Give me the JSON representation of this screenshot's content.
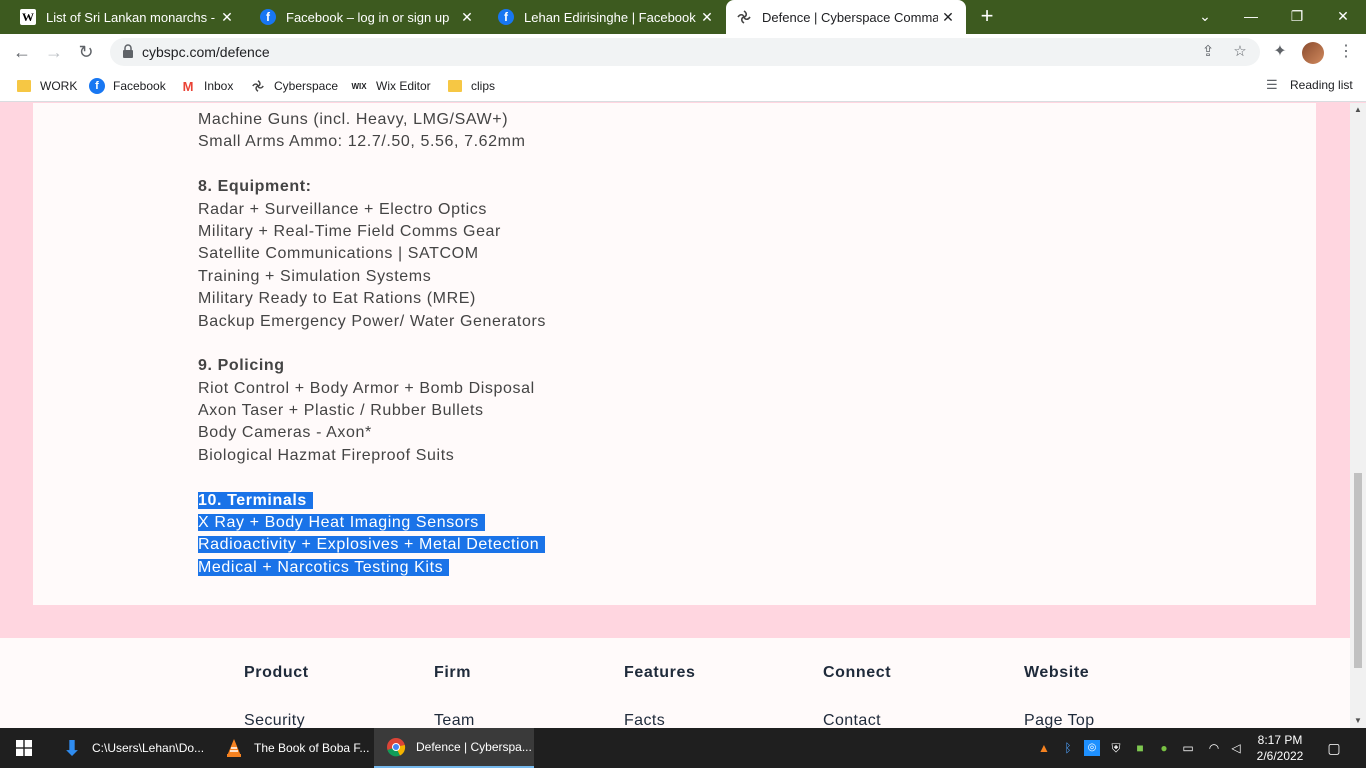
{
  "browser": {
    "tabs": [
      {
        "title": "List of Sri Lankan monarchs - Wik",
        "favicon": "wikipedia-icon",
        "active": false
      },
      {
        "title": "Facebook – log in or sign up",
        "favicon": "facebook-icon",
        "active": false
      },
      {
        "title": "Lehan Edirisinghe | Facebook",
        "favicon": "facebook-icon",
        "active": false
      },
      {
        "title": "Defence | Cyberspace Command",
        "favicon": "cyberspace-icon",
        "active": true
      }
    ],
    "url": "cybspc.com/defence",
    "bookmarks": [
      {
        "label": "WORK",
        "icon": "folder-icon"
      },
      {
        "label": "Facebook",
        "icon": "facebook-icon"
      },
      {
        "label": "Inbox",
        "icon": "gmail-icon"
      },
      {
        "label": "Cyberspace",
        "icon": "cyberspace-icon"
      },
      {
        "label": "Wix Editor",
        "icon": "wix-icon"
      },
      {
        "label": "clips",
        "icon": "folder-icon"
      }
    ],
    "reading_list": "Reading list"
  },
  "page": {
    "lines": [
      {
        "text": "Machine Guns (incl. Heavy, LMG/SAW+)",
        "kind": "item"
      },
      {
        "text": "Small Arms Ammo: 12.7/.50, 5.56, 7.62mm",
        "kind": "item"
      },
      {
        "text": "",
        "kind": "gap"
      },
      {
        "text": "8. Equipment:",
        "kind": "head"
      },
      {
        "text": "Radar + Surveillance + Electro Optics",
        "kind": "item"
      },
      {
        "text": "Military + Real-Time Field Comms Gear",
        "kind": "item"
      },
      {
        "text": "Satellite Communications | SATCOM",
        "kind": "item"
      },
      {
        "text": "Training + Simulation Systems",
        "kind": "item"
      },
      {
        "text": "Military Ready to Eat Rations (MRE)",
        "kind": "item"
      },
      {
        "text": "Backup Emergency Power/ Water Generators",
        "kind": "item"
      },
      {
        "text": "",
        "kind": "gap"
      },
      {
        "text": "9. Policing",
        "kind": "head"
      },
      {
        "text": "Riot Control + Body Armor + Bomb Disposal",
        "kind": "item"
      },
      {
        "text": "Axon Taser + Plastic / Rubber Bullets",
        "kind": "item"
      },
      {
        "text": "Body Cameras - Axon*",
        "kind": "item"
      },
      {
        "text": "Biological Hazmat Fireproof Suits",
        "kind": "item"
      },
      {
        "text": "",
        "kind": "gap"
      },
      {
        "text": "10. Terminals",
        "kind": "head",
        "selected": true
      },
      {
        "text": "X Ray + Body Heat Imaging Sensors",
        "kind": "item",
        "selected": true
      },
      {
        "text": "Radioactivity + Explosives + Metal Detection",
        "kind": "item",
        "selected": true
      },
      {
        "text": "Medical + Narcotics Testing Kits",
        "kind": "item",
        "selected": true
      }
    ],
    "footer": [
      {
        "heading": "Product",
        "link": "Security"
      },
      {
        "heading": "Firm",
        "link": "Team"
      },
      {
        "heading": "Features",
        "link": "Facts"
      },
      {
        "heading": "Connect",
        "link": "Contact"
      },
      {
        "heading": "Website",
        "link": "Page Top"
      }
    ]
  },
  "taskbar": {
    "items": [
      {
        "label": "C:\\Users\\Lehan\\Do...",
        "icon": "download-icon"
      },
      {
        "label": "The Book of Boba F...",
        "icon": "vlc-icon"
      },
      {
        "label": "Defence | Cyberspa...",
        "icon": "chrome-icon",
        "active": true
      }
    ],
    "time": "8:17 PM",
    "date": "2/6/2022"
  },
  "colors": {
    "tabstrip": "#3d5a1f",
    "selection": "#1a73e8",
    "page_bg": "#ffd6e0"
  }
}
